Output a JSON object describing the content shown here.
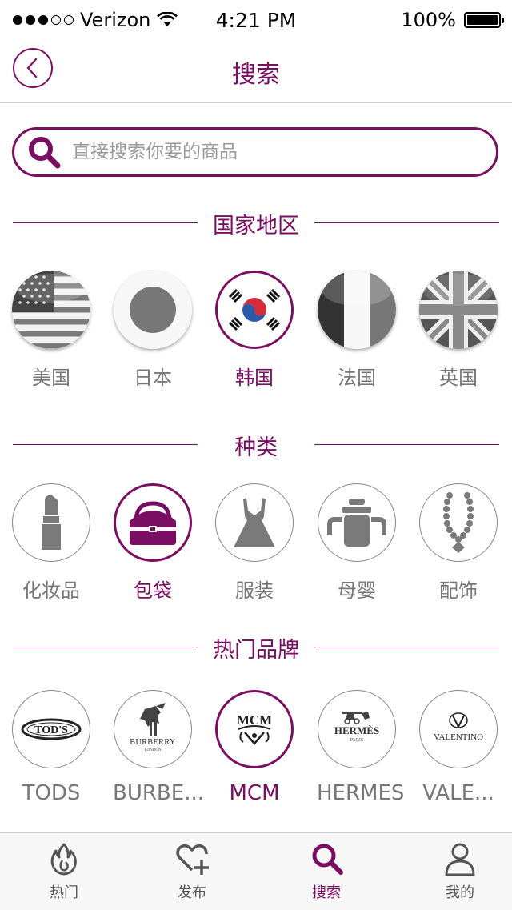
{
  "status_bar": {
    "carrier": "Verizon",
    "time": "4:21 PM",
    "battery": "100%"
  },
  "nav": {
    "title": "搜索"
  },
  "search": {
    "placeholder": "直接搜索你要的商品"
  },
  "sections": {
    "regions": {
      "title": "国家地区",
      "items": [
        {
          "label": "美国",
          "icon": "us-flag-icon",
          "selected": false
        },
        {
          "label": "日本",
          "icon": "japan-flag-icon",
          "selected": false
        },
        {
          "label": "韩国",
          "icon": "korea-flag-icon",
          "selected": true
        },
        {
          "label": "法国",
          "icon": "france-flag-icon",
          "selected": false
        },
        {
          "label": "英国",
          "icon": "uk-flag-icon",
          "selected": false
        }
      ]
    },
    "categories": {
      "title": "种类",
      "items": [
        {
          "label": "化妆品",
          "icon": "lipstick-icon",
          "selected": false
        },
        {
          "label": "包袋",
          "icon": "handbag-icon",
          "selected": true
        },
        {
          "label": "服装",
          "icon": "dress-icon",
          "selected": false
        },
        {
          "label": "母婴",
          "icon": "sippy-cup-icon",
          "selected": false
        },
        {
          "label": "配饰",
          "icon": "necklace-icon",
          "selected": false
        }
      ]
    },
    "brands": {
      "title": "热门品牌",
      "items": [
        {
          "label": "TODS",
          "logo_text": "TOD'S",
          "selected": false
        },
        {
          "label": "BURBE...",
          "logo_text": "BURBERRY",
          "logo_subtext": "LONDON",
          "selected": false
        },
        {
          "label": "MCM",
          "logo_text": "MCM",
          "selected": true
        },
        {
          "label": "HERMES",
          "logo_text": "HERMÈS",
          "logo_subtext": "PARIS",
          "selected": false
        },
        {
          "label": "VALE...",
          "logo_text": "VALENTINO",
          "selected": false
        }
      ]
    }
  },
  "tab_bar": {
    "items": [
      {
        "label": "热门",
        "icon": "flame-icon",
        "active": false
      },
      {
        "label": "发布",
        "icon": "heart-plus-icon",
        "active": false
      },
      {
        "label": "搜索",
        "icon": "search-icon",
        "active": true
      },
      {
        "label": "我的",
        "icon": "person-icon",
        "active": false
      }
    ]
  },
  "colors": {
    "accent": "#7a0e62",
    "inactive": "#777777",
    "divider": "#cfcfcf"
  }
}
